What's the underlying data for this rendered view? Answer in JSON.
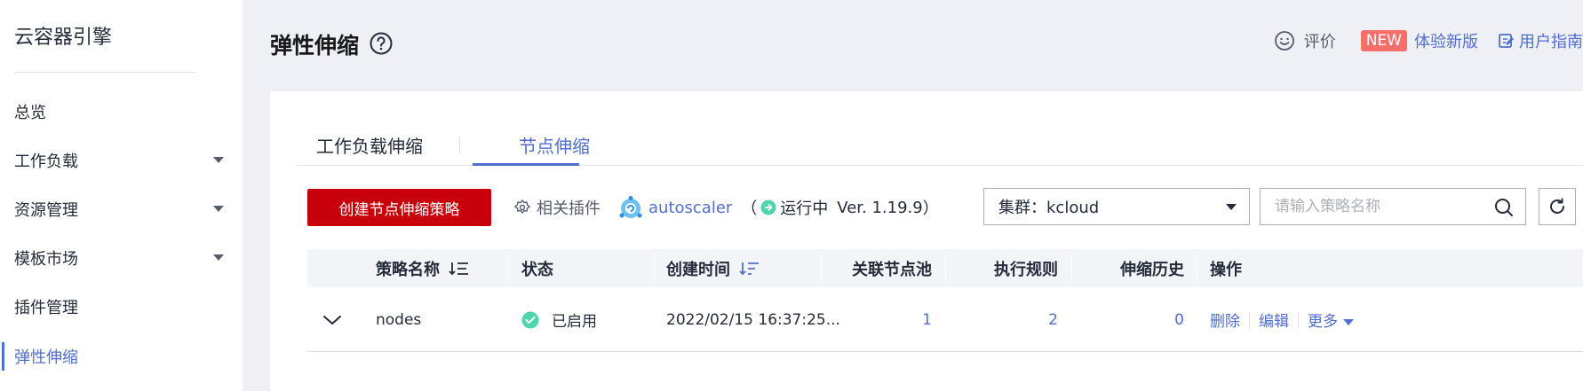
{
  "sidebar": {
    "brand": "云容器引擎",
    "items": [
      {
        "label": "总览",
        "expandable": false,
        "active": false
      },
      {
        "label": "工作负载",
        "expandable": true,
        "active": false
      },
      {
        "label": "资源管理",
        "expandable": true,
        "active": false
      },
      {
        "label": "模板市场",
        "expandable": true,
        "active": false
      },
      {
        "label": "插件管理",
        "expandable": false,
        "active": false
      },
      {
        "label": "弹性伸缩",
        "expandable": false,
        "active": true
      }
    ]
  },
  "header": {
    "title": "弹性伸缩",
    "rate_label": "评价",
    "new_badge": "NEW",
    "try_new_label": "体验新版",
    "guide_label": "用户指南"
  },
  "tabs": [
    {
      "label": "工作负载伸缩",
      "active": false
    },
    {
      "label": "节点伸缩",
      "active": true
    }
  ],
  "toolbar": {
    "create_label": "创建节点伸缩策略",
    "plugin_label": "相关插件",
    "autoscaler_name": "autoscaler",
    "paren_open": "（",
    "status_label": "运行中",
    "version": "Ver. 1.19.9",
    "paren_close": "）",
    "cluster_label": "集群：kcloud",
    "search_placeholder": "请输入策略名称"
  },
  "table": {
    "headers": {
      "name": "策略名称",
      "status": "状态",
      "created": "创建时间",
      "pools": "关联节点池",
      "rules": "执行规则",
      "history": "伸缩历史",
      "ops": "操作"
    },
    "rows": [
      {
        "name": "nodes",
        "status": "已启用",
        "created": "2022/02/15 16:37:25...",
        "pools": "1",
        "rules": "2",
        "history": "0",
        "op_delete": "删除",
        "op_edit": "编辑",
        "op_more": "更多"
      }
    ]
  },
  "colors": {
    "brand_red": "#c7000b",
    "link_blue": "#526ecc",
    "success_green": "#50d4ab",
    "new_badge": "#f66f6a"
  }
}
